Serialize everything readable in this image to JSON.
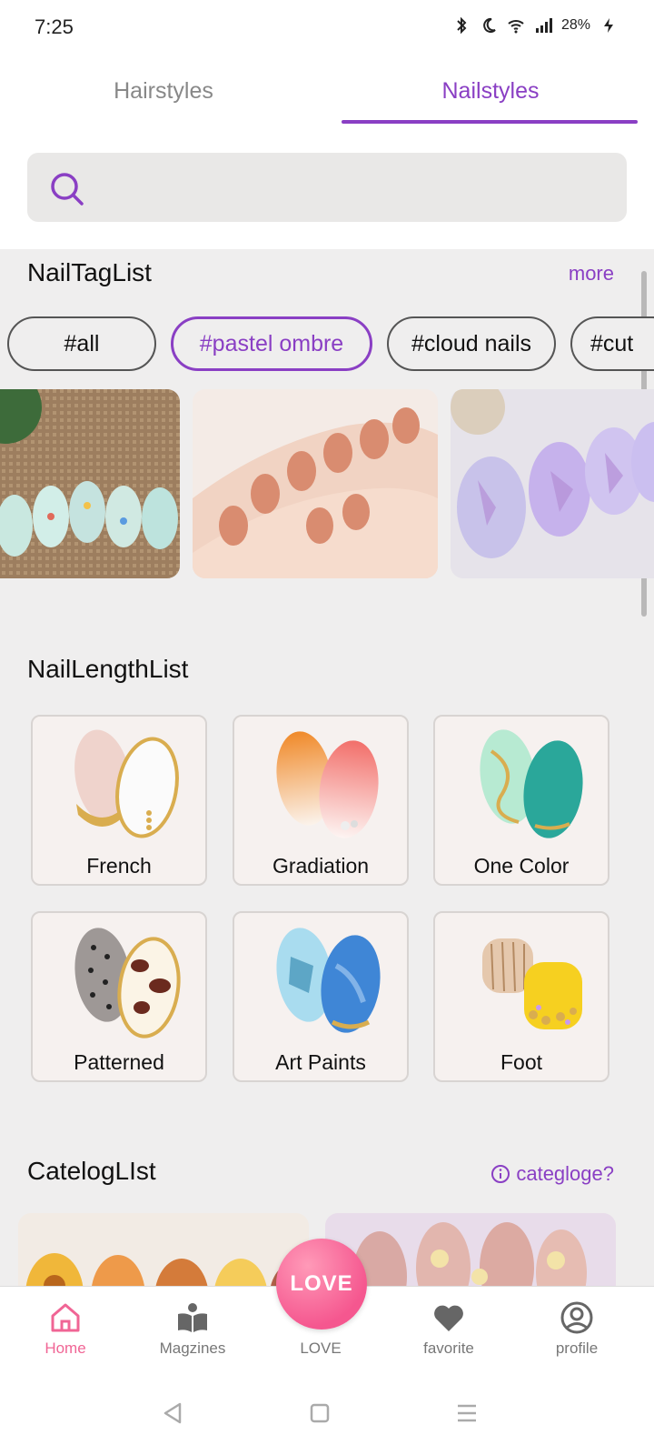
{
  "status": {
    "time": "7:25",
    "battery": "28%"
  },
  "tabs": [
    {
      "label": "Hairstyles",
      "active": false
    },
    {
      "label": "Nailstyles",
      "active": true
    }
  ],
  "search": {
    "value": "",
    "placeholder": ""
  },
  "tag_section": {
    "title": "NailTagList",
    "more": "more",
    "chips": [
      {
        "label": "#all",
        "active": false
      },
      {
        "label": "#pastel ombre",
        "active": true
      },
      {
        "label": "#cloud nails",
        "active": false
      },
      {
        "label": "#cut",
        "active": false
      }
    ]
  },
  "length_section": {
    "title": "NailLengthList",
    "items": [
      {
        "label": "French"
      },
      {
        "label": "Gradiation"
      },
      {
        "label": "One Color"
      },
      {
        "label": "Patterned"
      },
      {
        "label": "Art Paints"
      },
      {
        "label": "Foot"
      }
    ]
  },
  "catalog_section": {
    "title": "CatelogLIst",
    "info": "categloge?"
  },
  "bottom_nav": {
    "items": [
      {
        "label": "Home",
        "icon": "home-icon",
        "active": true
      },
      {
        "label": "Magzines",
        "icon": "book-icon",
        "active": false
      },
      {
        "label": "LOVE",
        "icon": "love-icon",
        "active": false
      },
      {
        "label": "favorite",
        "icon": "heart-icon",
        "active": false
      },
      {
        "label": "profile",
        "icon": "user-icon",
        "active": false
      }
    ],
    "love_button": "LOVE"
  },
  "colors": {
    "accent": "#8a3fc4",
    "pink": "#f06595",
    "background": "#efeeee"
  }
}
